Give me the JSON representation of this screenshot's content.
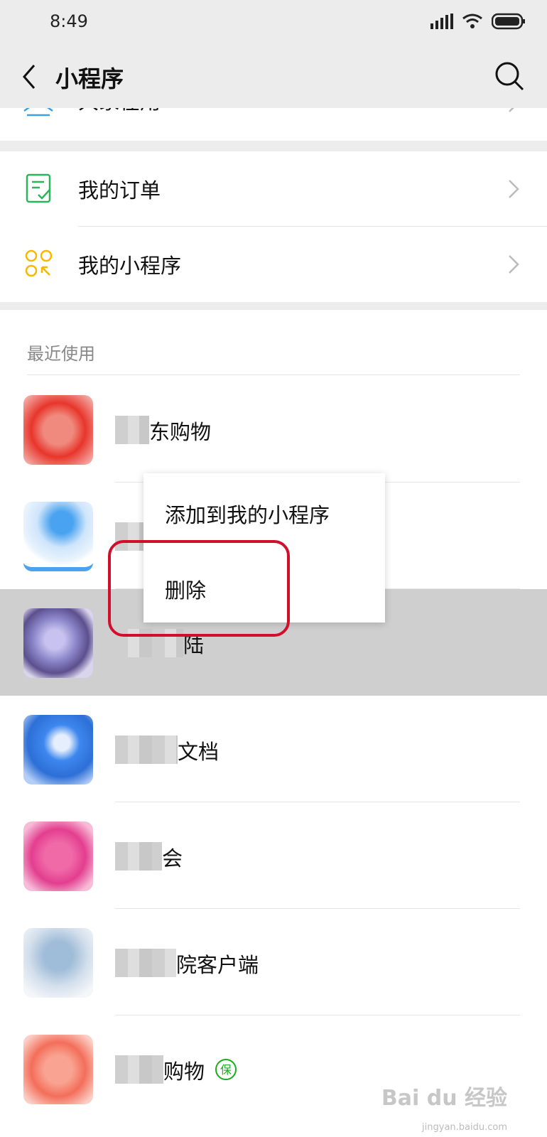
{
  "status_bar": {
    "time": "8:49"
  },
  "nav": {
    "title": "小程序",
    "back_icon": "back-arrow-icon",
    "search_icon": "search-icon"
  },
  "top_partial": {
    "label": "大家在用"
  },
  "menu": {
    "items": [
      {
        "label": "我的订单",
        "icon": "order-icon",
        "icon_color": "#2bb55a"
      },
      {
        "label": "我的小程序",
        "icon": "mini-programs-icon",
        "icon_color": "#f5b800"
      }
    ]
  },
  "recent": {
    "header": "最近使用",
    "apps": [
      {
        "name": "东购物",
        "icon_color": "#e8352b"
      },
      {
        "name": "",
        "icon_color": "#4aa3f0"
      },
      {
        "name": "陆",
        "icon_color": "#8a86c9"
      },
      {
        "name": "文档",
        "icon_color": "#3d87ee"
      },
      {
        "name": "会",
        "icon_color": "#e33e8f"
      },
      {
        "name": "院客户端",
        "icon_color": "#9fbcd8"
      },
      {
        "name": "购物",
        "icon_color": "#f36e5a",
        "badge": "保"
      }
    ]
  },
  "context_menu": {
    "items": [
      {
        "label": "添加到我的小程序"
      },
      {
        "label": "删除"
      }
    ]
  },
  "watermark": {
    "main": "Bai du 经验",
    "sub": "jingyan.baidu.com"
  }
}
